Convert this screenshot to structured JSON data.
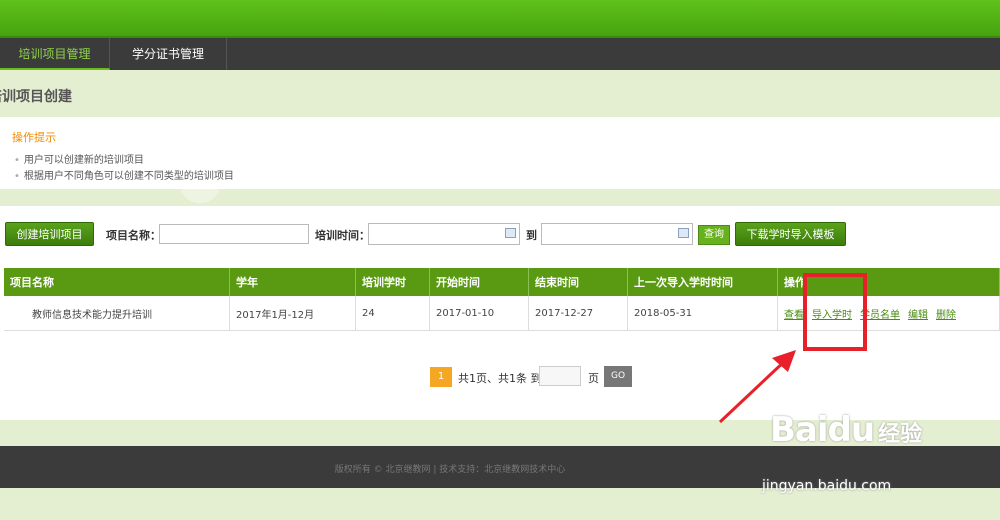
{
  "nav": {
    "tabs": [
      {
        "label": "培训项目管理",
        "active": true
      },
      {
        "label": "学分证书管理",
        "active": false
      }
    ]
  },
  "page_title": "培训项目创建",
  "tips": {
    "title": "操作提示",
    "items": [
      "用户可以创建新的培训项目",
      "根据用户不同角色可以创建不同类型的培训项目"
    ]
  },
  "toolbar": {
    "create_label": "创建培训项目",
    "name_label": "项目名称：",
    "name_value": "",
    "time_label": "培训时间：",
    "start_value": "",
    "to_label": "到",
    "end_value": "",
    "query_label": "查询",
    "download_label": "下载学时导入模板"
  },
  "table": {
    "headers": [
      "项目名称",
      "学年",
      "培训学时",
      "开始时间",
      "结束时间",
      "上一次导入学时时间",
      "操作"
    ],
    "rows": [
      {
        "name": "教师信息技术能力提升培训",
        "year": "2017年1月-12月",
        "hours": "24",
        "start": "2017-01-10",
        "end": "2017-12-27",
        "last_import": "2018-05-31",
        "actions": [
          "查看",
          "导入学时",
          "学员名单",
          "编辑",
          "删除"
        ]
      }
    ]
  },
  "pager": {
    "current": "1",
    "summary": "共1页、共1条 到",
    "page_unit": "页",
    "go_label": "GO"
  },
  "footer": {
    "text": "版权所有 © 北京继教网 | 技术支持：北京继教网技术中心"
  },
  "watermark": {
    "brand": "Baidu",
    "jingyan": "经验",
    "url": "jingyan.baidu.com"
  },
  "colors": {
    "accent": "#5a9a12",
    "highlight": "#e8202a",
    "tips_title": "#f08a00"
  }
}
